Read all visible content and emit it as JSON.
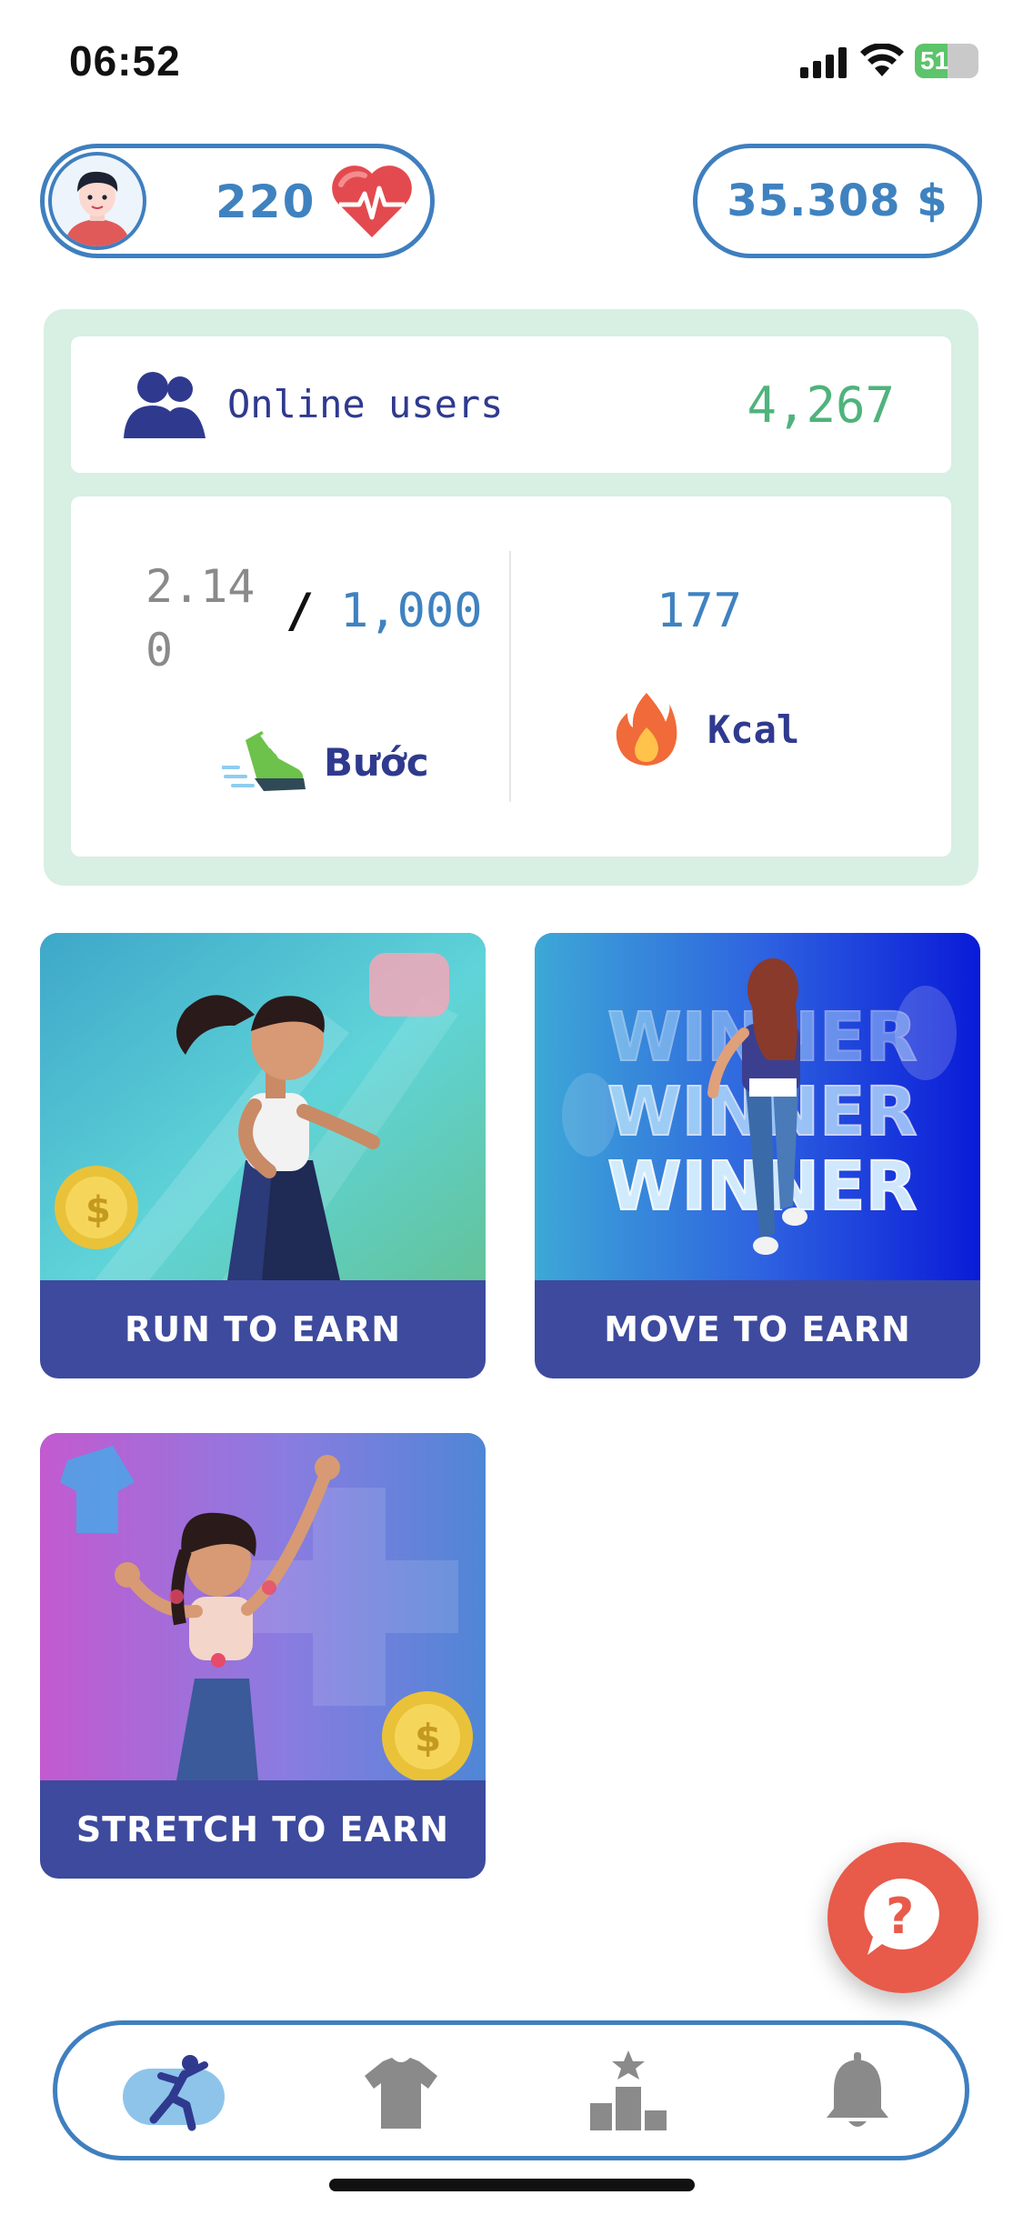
{
  "status_bar": {
    "time": "06:52",
    "battery": "51",
    "battery_level": 0.51
  },
  "header": {
    "hp": "220",
    "balance": "35.308 $"
  },
  "stats": {
    "online_label": "Online users",
    "online_count": "4,267",
    "steps_current": "2.140",
    "steps_sep": "/",
    "steps_goal": "1,000",
    "steps_label": "Bước",
    "kcal_value": "177",
    "kcal_label": "Kcal"
  },
  "tiles": [
    {
      "label": "RUN TO EARN"
    },
    {
      "label": "MOVE TO EARN",
      "art_text": [
        "WINNER",
        "WINNER",
        "WINNER"
      ]
    },
    {
      "label": "STRETCH TO EARN"
    }
  ],
  "help_button": {
    "icon": "question-chat-icon",
    "color": "#e85a4a"
  },
  "bottom_nav": {
    "items": [
      {
        "icon": "workout-icon",
        "active": true
      },
      {
        "icon": "tshirt-icon",
        "active": false
      },
      {
        "icon": "leaderboard-icon",
        "active": false
      },
      {
        "icon": "bell-icon",
        "active": false
      }
    ]
  },
  "colors": {
    "accent": "#3f82c0",
    "brand_navy": "#2f3a8f",
    "panel_green": "#d8efe3",
    "online_green": "#4fb37c",
    "tile_label_bg": "#3d4a9e"
  }
}
